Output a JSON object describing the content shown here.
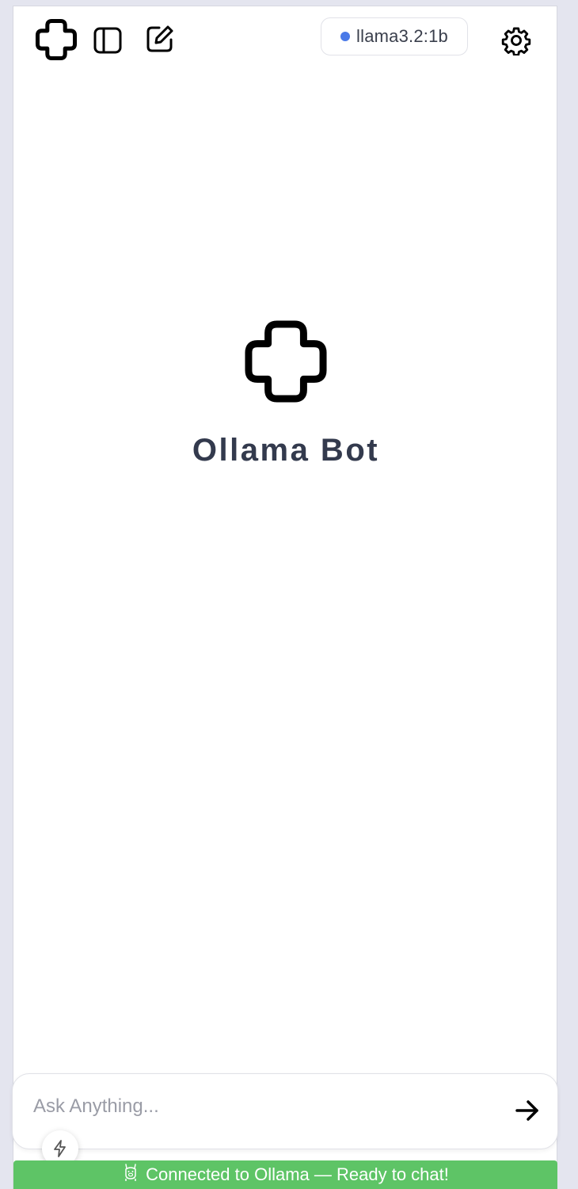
{
  "header": {
    "model_name": "llama3.2:1b",
    "model_status_color": "#4a7ae8"
  },
  "icons": {
    "logo": "ollama-cross-logo",
    "sidebar_toggle": "sidebar-panel-icon",
    "new_chat": "compose-edit-icon",
    "settings": "gear-icon",
    "send": "arrow-right-icon",
    "quick_actions": "lightning-bolt-icon",
    "status": "llama-icon"
  },
  "main": {
    "title": "Ollama Bot"
  },
  "composer": {
    "placeholder": "Ask Anything...",
    "value": ""
  },
  "status": {
    "text": "Connected to Ollama — Ready to chat!",
    "color": "#5ec466"
  }
}
